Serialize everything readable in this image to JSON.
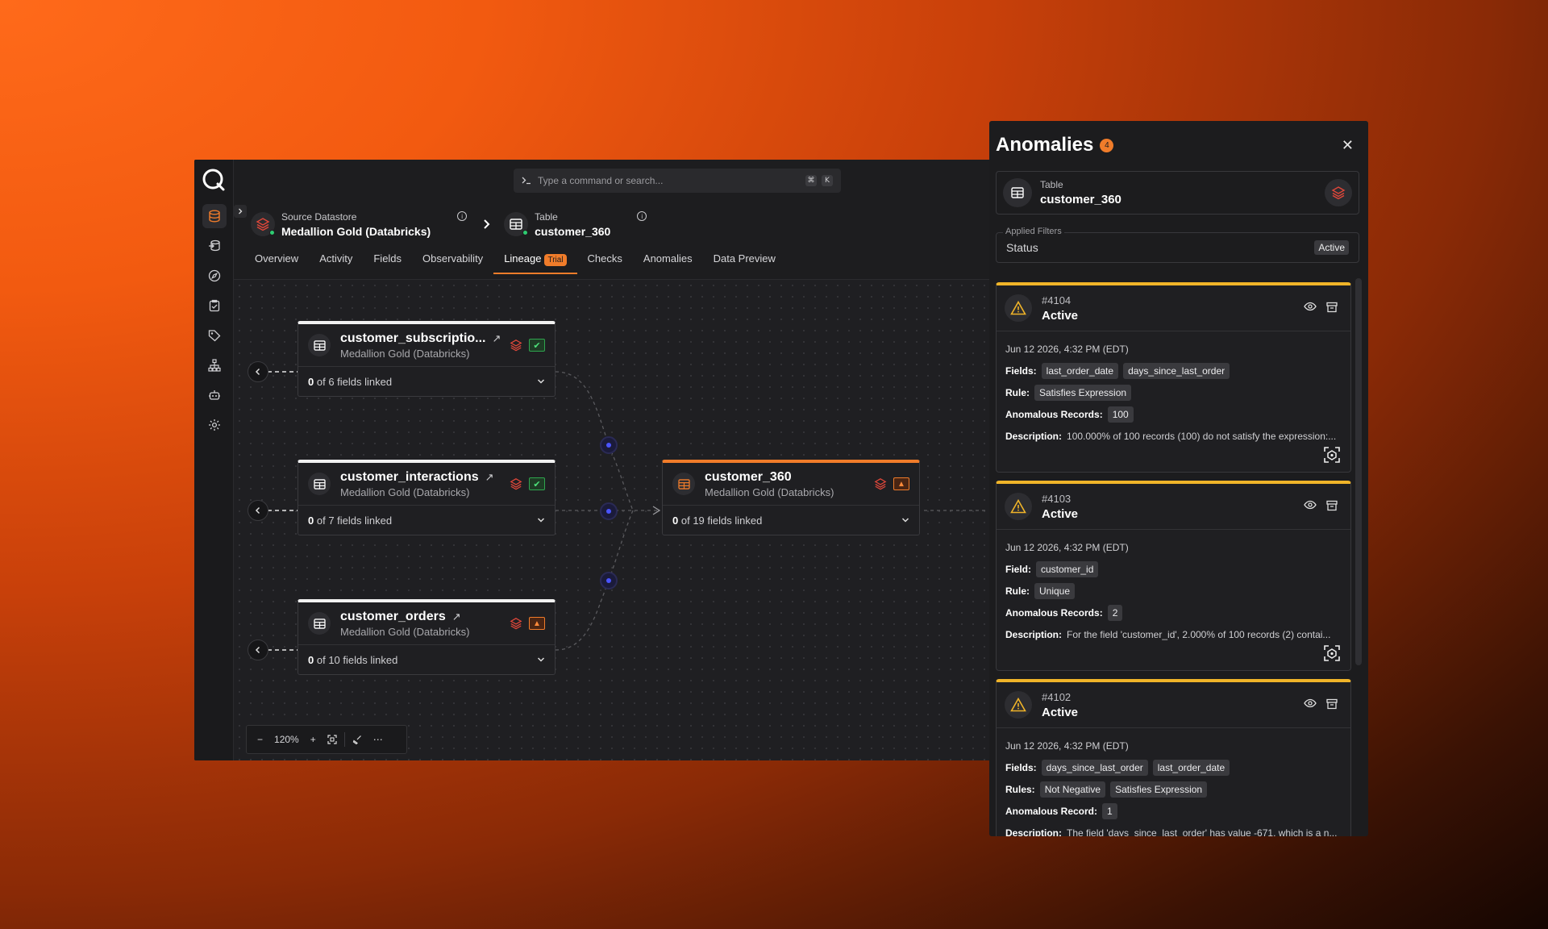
{
  "command_bar": {
    "placeholder": "Type a command or search...",
    "shortcut_mod": "⌘",
    "shortcut_key": "K"
  },
  "breadcrumb": {
    "source": {
      "kind": "Source Datastore",
      "name": "Medallion Gold (Databricks)"
    },
    "table": {
      "kind": "Table",
      "name": "customer_360"
    }
  },
  "tabs": [
    {
      "label": "Overview"
    },
    {
      "label": "Activity"
    },
    {
      "label": "Fields"
    },
    {
      "label": "Observability"
    },
    {
      "label": "Lineage",
      "badge": "Trial",
      "active": true
    },
    {
      "label": "Checks"
    },
    {
      "label": "Anomalies"
    },
    {
      "label": "Data Preview"
    }
  ],
  "lineage": {
    "nodes": [
      {
        "name": "customer_subscriptio...",
        "source": "Medallion Gold (Databricks)",
        "linked_count": "0",
        "linked_rest": "of 6 fields linked",
        "status": "ok"
      },
      {
        "name": "customer_interactions",
        "source": "Medallion Gold (Databricks)",
        "linked_count": "0",
        "linked_rest": "of 7 fields linked",
        "status": "ok"
      },
      {
        "name": "customer_orders",
        "source": "Medallion Gold (Databricks)",
        "linked_count": "0",
        "linked_rest": "of 10 fields linked",
        "status": "warn"
      }
    ],
    "target": {
      "name": "customer_360",
      "source": "Medallion Gold (Databricks)",
      "linked_count": "0",
      "linked_rest": "of 19 fields linked",
      "status": "warn"
    },
    "zoom": "120%"
  },
  "anomalies_panel": {
    "title": "Anomalies",
    "count": "4",
    "table_kind": "Table",
    "table_name": "customer_360",
    "filters_legend": "Applied Filters",
    "filter_key": "Status",
    "filter_value": "Active",
    "cards": [
      {
        "id": "#4104",
        "status": "Active",
        "date": "Jun 12 2026, 4:32 PM (EDT)",
        "fields_label": "Fields:",
        "fields": [
          "last_order_date",
          "days_since_last_order"
        ],
        "rule_label": "Rule:",
        "rules": [
          "Satisfies Expression"
        ],
        "records_label": "Anomalous Records:",
        "records": "100",
        "desc_label": "Description:",
        "description": "100.000% of 100 records (100) do not satisfy the expression:..."
      },
      {
        "id": "#4103",
        "status": "Active",
        "date": "Jun 12 2026, 4:32 PM (EDT)",
        "fields_label": "Field:",
        "fields": [
          "customer_id"
        ],
        "rule_label": "Rule:",
        "rules": [
          "Unique"
        ],
        "records_label": "Anomalous Records:",
        "records": "2",
        "desc_label": "Description:",
        "description": "For the field 'customer_id', 2.000% of 100 records (2) contai..."
      },
      {
        "id": "#4102",
        "status": "Active",
        "date": "Jun 12 2026, 4:32 PM (EDT)",
        "fields_label": "Fields:",
        "fields": [
          "days_since_last_order",
          "last_order_date"
        ],
        "rule_label": "Rules:",
        "rules": [
          "Not Negative",
          "Satisfies Expression"
        ],
        "records_label": "Anomalous Record:",
        "records": "1",
        "desc_label": "Description:",
        "description": "The field 'days_since_last_order' has value -671, which is a n..."
      }
    ]
  },
  "colors": {
    "accent": "#f07c2a",
    "warning": "#f0b429",
    "ok": "#2fa64e",
    "junction": "#4b55ff"
  }
}
